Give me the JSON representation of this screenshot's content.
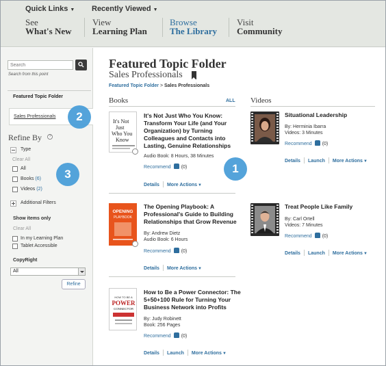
{
  "topnav": {
    "quick_links": "Quick Links",
    "recently_viewed": "Recently Viewed",
    "items": [
      {
        "small": "See",
        "big": "What's New"
      },
      {
        "small": "View",
        "big": "Learning Plan"
      },
      {
        "small": "Browse",
        "big": "The Library"
      },
      {
        "small": "Visit",
        "big": "Community"
      }
    ]
  },
  "sidebar": {
    "search_placeholder": "Search",
    "search_hint": "Search from this point",
    "featured_label": "Featured Topic Folder",
    "current_folder": "Sales Professionals",
    "refine_title": "Refine By",
    "help": "?",
    "type_label": "Type",
    "clear_all": "Clear All",
    "type_options": [
      {
        "label": "All",
        "count": ""
      },
      {
        "label": "Books",
        "count": "(6)"
      },
      {
        "label": "Videos",
        "count": "(2)"
      }
    ],
    "additional_filters": "Additional Filters",
    "show_items_only": "Show items only",
    "clear_all_2": "Clear All",
    "show_options": [
      "In my Learning Plan",
      "Tablet Accessible"
    ],
    "copyright_label": "CopyRight",
    "copyright_value": "All",
    "refine_button": "Refine"
  },
  "main": {
    "title": "Featured Topic Folder",
    "subtitle": "Sales Professionals",
    "breadcrumb_link": "Featured Topic Folder",
    "breadcrumb_sep": ">",
    "breadcrumb_current": "Sales Professionals",
    "books_title": "Books",
    "all_link": "ALL",
    "videos_title": "Videos",
    "recommend": "Recommend",
    "books": [
      {
        "title": "It's Not Just Who You Know: Transform Your Life (and Your Organization) by Turning Colleagues and Contacts into Lasting, Genuine Relationships",
        "author": "",
        "meta": "Audio Book: 8 Hours, 38 Minutes",
        "count": "(0)",
        "actions": [
          "Details",
          "More Actions"
        ],
        "cover_text": "It's Not Just Who You Know",
        "cover_color": "#ffffff"
      },
      {
        "title": "The Opening Playbook: A Professional's Guide to Building Relationships that Grow Revenue",
        "author": "By: Andrew Dietz",
        "meta": "Audio Book: 6 Hours",
        "count": "(0)",
        "actions": [
          "Details",
          "More Actions"
        ],
        "cover_text": "OPENING PLAYBOOK",
        "cover_color": "#e8541c"
      },
      {
        "title": "How to Be a Power Connector: The 5+50+100 Rule for Turning Your Business Network into Profits",
        "author": "By: Judy Robinett",
        "meta": "Book: 256 Pages",
        "count": "(0)",
        "actions": [
          "Details",
          "Launch",
          "More Actions"
        ],
        "cover_text": "POWER CONNECTOR",
        "cover_color": "#ffffff"
      }
    ],
    "videos": [
      {
        "title": "Situational Leadership",
        "author": "By: Herminia Ibarra",
        "meta": "Videos: 3 Minutes",
        "count": "(0)",
        "actions": [
          "Details",
          "Launch",
          "More Actions"
        ]
      },
      {
        "title": "Treat People Like Family",
        "author": "By: Carl Ortell",
        "meta": "Videos: 7 Minutes",
        "count": "(0)",
        "actions": [
          "Details",
          "Launch",
          "More Actions"
        ]
      }
    ]
  },
  "callouts": [
    "1",
    "2",
    "3"
  ],
  "colors": {
    "link": "#2e6e9e",
    "nav_bg": "#e4e7e2",
    "callout": "#4b9fd9"
  }
}
